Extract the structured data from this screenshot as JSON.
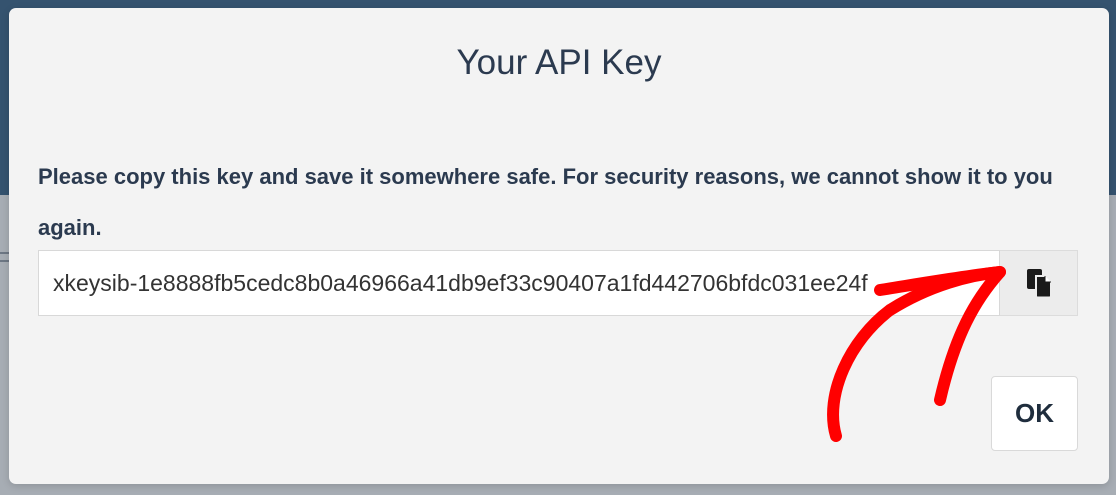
{
  "modal": {
    "title": "Your API Key",
    "message": "Please copy this key and save it somewhere safe. For security reasons, we cannot show it to you again.",
    "api_key_value": "xkeysib-1e8888fb5cedc8b0a46966a41db9ef33c90407a1fd442706bfdc031ee24f",
    "copy_button_icon": "copy-icon",
    "ok_label": "OK"
  },
  "annotation": {
    "arrow_color": "#ff0000"
  },
  "colors": {
    "header_background": "#35536f",
    "modal_background": "#f3f3f3",
    "text": "#2b3a4f"
  }
}
